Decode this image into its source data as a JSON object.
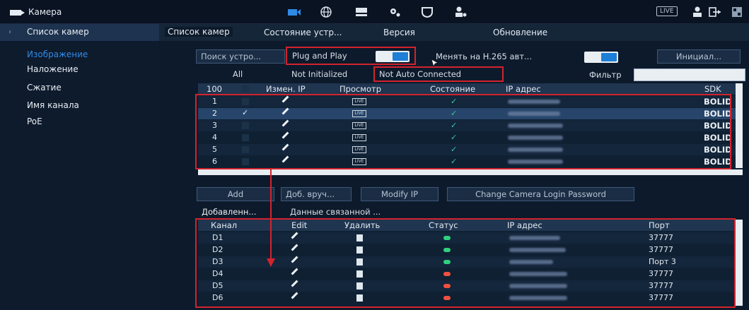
{
  "header": {
    "title": "Камера",
    "icons": [
      "camera-icon",
      "network-icon",
      "storage-icon",
      "system-settings-icon",
      "security-icon",
      "account-icon"
    ],
    "live_label": "LIVE"
  },
  "sidebar": {
    "items": [
      {
        "label": "Список камер",
        "active": true
      },
      {
        "label": "Изображение"
      },
      {
        "label": "Наложение"
      },
      {
        "label": "Сжатие"
      },
      {
        "label": "Имя канала"
      },
      {
        "label": "PoE"
      }
    ]
  },
  "tabs": [
    "Список камер",
    "Состояние устр...",
    "Версия",
    "Обновление"
  ],
  "toolbar": {
    "search_label": "Поиск устро...",
    "plug_play_label": "Plug and Play",
    "h265_label": "Менять на H.265 авт...",
    "init_label": "Инициал..."
  },
  "filters": {
    "all": "All",
    "not_initialized": "Not Initialized",
    "not_auto_connected": "Not Auto Connected",
    "filter_label": "Фильтр",
    "filter_value": ""
  },
  "device_table": {
    "count": "100",
    "columns": [
      "Измен. IP",
      "Просмотр",
      "Состояние",
      "IP адрес",
      "SDK"
    ],
    "rows": [
      {
        "n": "1",
        "checked": false,
        "sdk": "BOLID"
      },
      {
        "n": "2",
        "checked": true,
        "sdk": "BOLID"
      },
      {
        "n": "3",
        "checked": false,
        "sdk": "BOLID"
      },
      {
        "n": "4",
        "checked": false,
        "sdk": "BOLID"
      },
      {
        "n": "5",
        "checked": false,
        "sdk": "BOLID"
      },
      {
        "n": "6",
        "checked": false,
        "sdk": "BOLID"
      }
    ],
    "live_text": "LIVE"
  },
  "actions": {
    "add": "Add",
    "manual_add": "Доб. вруч...",
    "modify_ip": "Modify IP",
    "change_password": "Change Camera Login Password"
  },
  "lower_tabs": [
    "Добавленн...",
    "Данные связанной ..."
  ],
  "added_table": {
    "columns": [
      "Канал",
      "Edit",
      "Удалить",
      "Статус",
      "IP адрес",
      "Порт"
    ],
    "rows": [
      {
        "channel": "D1",
        "status": "online",
        "port": "37777"
      },
      {
        "channel": "D2",
        "status": "online",
        "port": "37777"
      },
      {
        "channel": "D3",
        "status": "online",
        "port": "Порт 3"
      },
      {
        "channel": "D4",
        "status": "offline",
        "port": "37777"
      },
      {
        "channel": "D5",
        "status": "offline",
        "port": "37777"
      },
      {
        "channel": "D6",
        "status": "offline",
        "port": "37777"
      }
    ]
  },
  "colors": {
    "online": "#2fd17f",
    "offline": "#f0503f",
    "highlight": "#d3232e",
    "accent": "#1e7fd6"
  }
}
